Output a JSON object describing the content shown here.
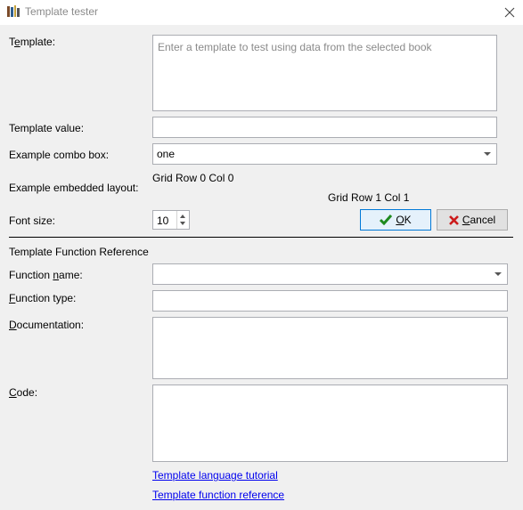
{
  "window": {
    "title": "Template tester",
    "close_icon": "close-icon",
    "app_icon": "books-icon"
  },
  "form": {
    "template_label_pre": "T",
    "template_label_u": "e",
    "template_label_post": "mplate:",
    "template_placeholder": "Enter a template to test using data from the selected book",
    "template_value_label": "Template value:",
    "template_value": "",
    "combo_label": "Example combo box:",
    "combo_value": "one",
    "embedded_label": "Example embedded layout:",
    "grid_r0c0": "Grid Row 0 Col 0",
    "grid_r1c1": "Grid Row 1 Col 1",
    "font_size_label": "Font size:",
    "font_size_value": "10"
  },
  "buttons": {
    "ok_u": "O",
    "ok_rest": "K",
    "cancel_u": "C",
    "cancel_rest": "ancel",
    "ok_icon": "checkmark-icon",
    "cancel_icon": "x-icon",
    "ok_color": "#1e8a1e",
    "cancel_color": "#cc1b1b"
  },
  "reference": {
    "section_title": "Template Function Reference",
    "fname_pre": "Function ",
    "fname_u": "n",
    "fname_post": "ame:",
    "ftype_u": "F",
    "ftype_post": "unction type:",
    "doc_u": "D",
    "doc_post": "ocumentation:",
    "code_u": "C",
    "code_post": "ode:"
  },
  "links": {
    "tutorial": "Template language tutorial",
    "function_reference": "Template function reference"
  }
}
